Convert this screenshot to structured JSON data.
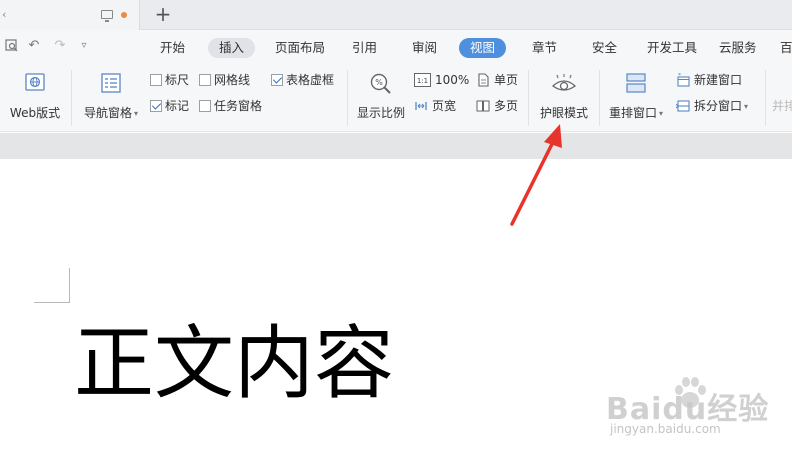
{
  "tab_strip": {
    "new_tab_label": "+"
  },
  "menu": {
    "items": [
      {
        "label": "开始",
        "state": "normal"
      },
      {
        "label": "插入",
        "state": "hover"
      },
      {
        "label": "页面布局",
        "state": "normal"
      },
      {
        "label": "引用",
        "state": "normal"
      },
      {
        "label": "审阅",
        "state": "normal"
      },
      {
        "label": "视图",
        "state": "active"
      },
      {
        "label": "章节",
        "state": "normal"
      },
      {
        "label": "安全",
        "state": "normal"
      },
      {
        "label": "开发工具",
        "state": "normal"
      },
      {
        "label": "云服务",
        "state": "normal"
      },
      {
        "label": "百",
        "state": "normal"
      }
    ]
  },
  "ribbon": {
    "web_layout": "Web版式",
    "nav_pane": "导航窗格",
    "ruler": "标尺",
    "gridlines": "网格线",
    "table_gridlines": "表格虚框",
    "marks": "标记",
    "task_pane": "任务窗格",
    "zoom": "显示比例",
    "zoom_100": "100%",
    "one_page": "单页",
    "page_width": "页宽",
    "multi_page": "多页",
    "eye_protect": "护眼模式",
    "rearrange_windows": "重排窗口",
    "new_window": "新建窗口",
    "split_window": "拆分窗口",
    "side_by_side": "并排",
    "one_to_one_icon_text": "1:1",
    "checkbox_states": {
      "ruler": false,
      "gridlines": false,
      "table_gridlines": true,
      "marks": true,
      "task_pane": false
    }
  },
  "document": {
    "body_text": "正文内容"
  },
  "watermark": {
    "brand": "Baidu经验",
    "url": "jingyan.baidu.com"
  },
  "colors": {
    "accent": "#4e8fde",
    "annotation_arrow": "#e8322c",
    "unsaved_dot": "#f08a3a"
  }
}
